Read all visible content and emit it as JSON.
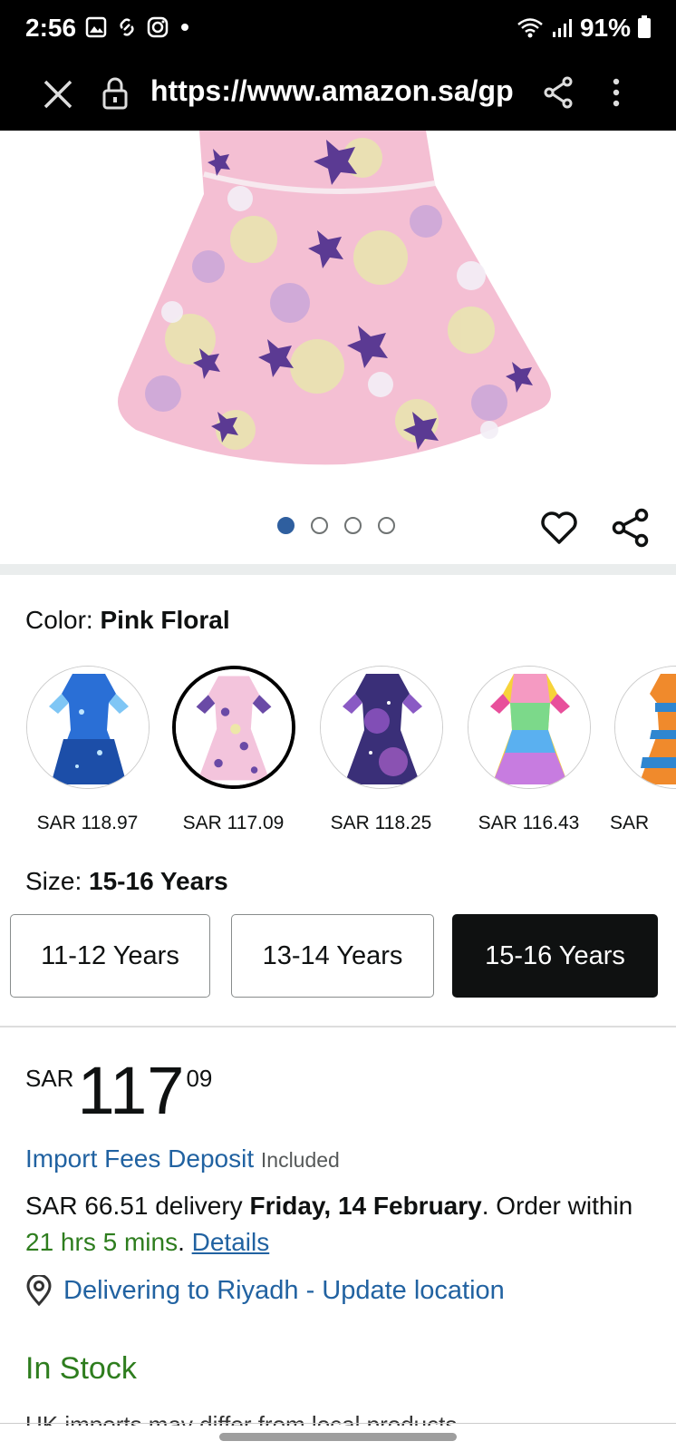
{
  "status_bar": {
    "time": "2:56",
    "battery": "91%",
    "icons": [
      "gallery-icon",
      "link-icon",
      "instagram-icon",
      "notification-dot",
      "wifi-icon",
      "signal-icon",
      "battery-icon"
    ]
  },
  "url_bar": {
    "url": "https://www.amazon.sa/gp/",
    "icons": [
      "close-icon",
      "lock-icon",
      "share-icon",
      "more-vert-icon"
    ]
  },
  "carousel": {
    "total_images": 4,
    "active_index": 0
  },
  "color": {
    "label": "Color:",
    "selected": "Pink Floral",
    "swatches": [
      {
        "price": "SAR 118.97",
        "colors": [
          "#2a6fd6",
          "#7fc6f5"
        ]
      },
      {
        "price": "SAR 117.09",
        "colors": [
          "#f3c4dc",
          "#6a4aa6"
        ]
      },
      {
        "price": "SAR 118.25",
        "colors": [
          "#3a2f78",
          "#a05bd0"
        ]
      },
      {
        "price": "SAR 116.43",
        "colors": [
          "#e84f9b",
          "#f7d33a"
        ]
      },
      {
        "price": "SAR",
        "colors": [
          "#f08a2c",
          "#2f86d0"
        ]
      }
    ]
  },
  "size": {
    "label": "Size:",
    "selected": "15-16 Years",
    "options": [
      "11-12 Years",
      "13-14 Years",
      "15-16 Years"
    ]
  },
  "price": {
    "currency": "SAR",
    "whole": "117",
    "fraction": "09"
  },
  "import_fees": {
    "link": "Import Fees Deposit",
    "note": "Included"
  },
  "delivery": {
    "cost": "SAR 66.51 delivery",
    "date": "Friday, 14 February",
    "order_within_prefix": ". Order within",
    "countdown": "21 hrs 5 mins",
    "details_link": "Details"
  },
  "location": {
    "text": "Delivering to Riyadh - Update location"
  },
  "stock": {
    "status": "In Stock",
    "cutoff_text": "UK imports may differ from local products"
  },
  "colors": {
    "link": "#2162a1",
    "green": "#2e7d1e",
    "dot_active": "#2f5f9f"
  }
}
